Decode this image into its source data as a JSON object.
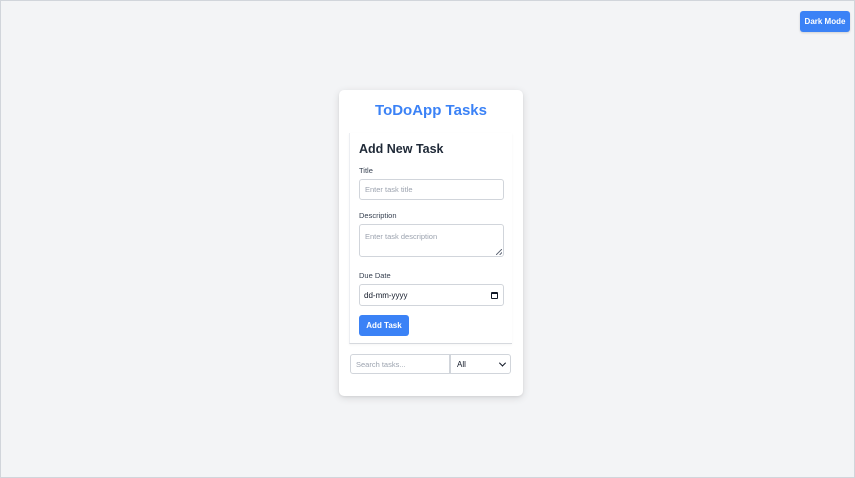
{
  "header": {
    "dark_mode_label": "Dark Mode"
  },
  "app": {
    "title": "ToDoApp Tasks"
  },
  "form": {
    "heading": "Add New Task",
    "title_label": "Title",
    "title_placeholder": "Enter task title",
    "description_label": "Description",
    "description_placeholder": "Enter task description",
    "due_date_label": "Due Date",
    "due_date_value": "dd-mm-yyyy",
    "submit_label": "Add Task"
  },
  "filters": {
    "search_placeholder": "Search tasks...",
    "status_selected": "All"
  },
  "colors": {
    "accent": "#3b82f6",
    "background": "#f3f4f6",
    "card": "#ffffff"
  },
  "icons": {
    "calendar": "calendar-icon",
    "dropdown": "chevron-down-icon"
  }
}
